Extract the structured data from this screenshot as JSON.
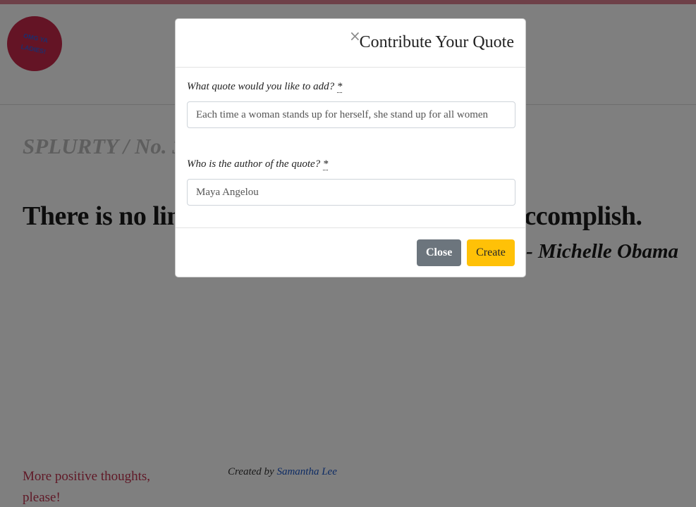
{
  "header": {
    "logo_text": "OMG YA LADIES!"
  },
  "main": {
    "issue": "SPLURTY / No. 3",
    "quote_text": "There is no limit to what we, as women, can accomplish.",
    "quote_author": "- Michelle Obama"
  },
  "footer": {
    "more_link": "More positive thoughts, please!",
    "credit_prefix": "Created by ",
    "credit_name": "Samantha Lee"
  },
  "modal": {
    "title": "Contribute Your Quote",
    "close_x": "×",
    "quote_label": "What quote would you like to add? ",
    "author_label": "Who is the author of the quote? ",
    "required_marker": "*",
    "quote_value": "Each time a woman stands up for herself, she stand up for all women",
    "author_value": "Maya Angelou",
    "close_button": "Close",
    "create_button": "Create"
  },
  "colors": {
    "accent_bar": "#dc8090",
    "logo_bg": "#c8294a",
    "close_button_bg": "#6c757d",
    "create_button_bg": "#ffc107",
    "link": "#1a56c8",
    "more_link": "#c0334f"
  }
}
